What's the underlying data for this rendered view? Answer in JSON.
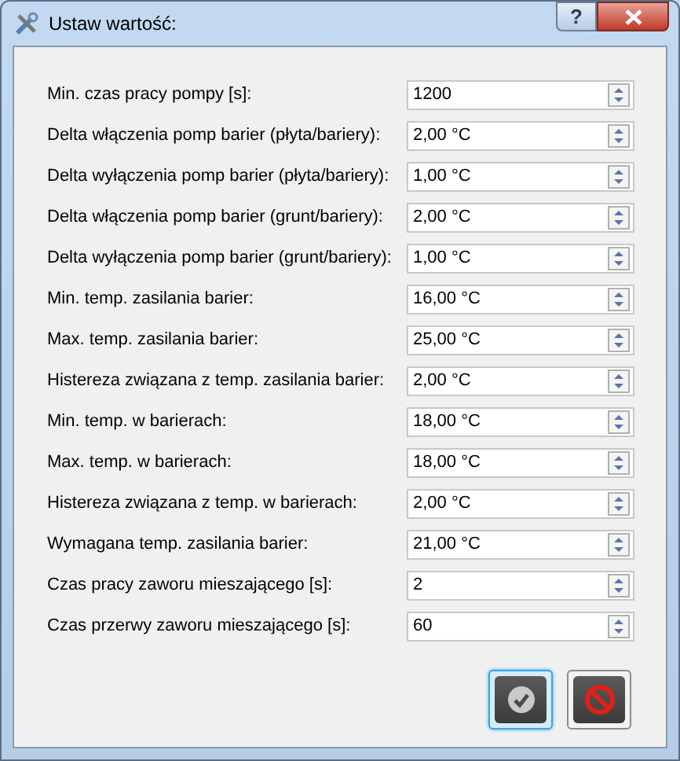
{
  "window": {
    "title": "Ustaw wartość:",
    "help_button": "?"
  },
  "fields": [
    {
      "label": "Min. czas pracy pompy [s]:",
      "value": "1200"
    },
    {
      "label": "Delta włączenia pomp barier (płyta/bariery):",
      "value": "2,00 °C"
    },
    {
      "label": "Delta wyłączenia pomp barier (płyta/bariery):",
      "value": "1,00 °C"
    },
    {
      "label": "Delta włączenia pomp barier (grunt/bariery):",
      "value": "2,00 °C"
    },
    {
      "label": "Delta wyłączenia pomp barier (grunt/bariery):",
      "value": "1,00 °C"
    },
    {
      "label": "Min. temp. zasilania barier:",
      "value": "16,00 °C"
    },
    {
      "label": "Max. temp. zasilania barier:",
      "value": "25,00 °C"
    },
    {
      "label": "Histereza związana z temp. zasilania barier:",
      "value": "2,00 °C"
    },
    {
      "label": "Min. temp. w barierach:",
      "value": "18,00 °C"
    },
    {
      "label": "Max. temp. w barierach:",
      "value": "18,00 °C"
    },
    {
      "label": "Histereza związana z temp. w barierach:",
      "value": "2,00 °C"
    },
    {
      "label": "Wymagana temp. zasilania barier:",
      "value": "21,00 °C"
    },
    {
      "label": "Czas pracy zaworu mieszającego [s]:",
      "value": "2"
    },
    {
      "label": "Czas przerwy zaworu mieszającego [s]:",
      "value": "60"
    }
  ],
  "buttons": [
    {
      "kind": "ok",
      "focused": true
    },
    {
      "kind": "cancel",
      "focused": false
    }
  ]
}
